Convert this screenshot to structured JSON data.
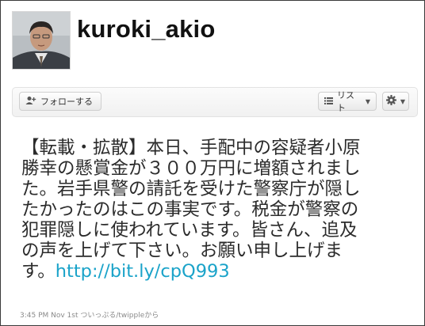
{
  "profile": {
    "username": "kuroki_akio",
    "avatar_icon": "profile-photo"
  },
  "actions": {
    "follow_label": "フォローする",
    "follow_icon": "add-person-icon",
    "list_label": "リスト",
    "list_icon": "list-icon",
    "gear_icon": "gear-icon"
  },
  "tweet": {
    "text": "【転載・拡散】本日、手配中の容疑者小原勝幸の懸賞金が３００万円に増額されました。岩手県警の請託を受けた警察庁が隠したかったのはこの事実です。税金が警察の犯罪隠しに使われています。皆さん、追及の声を上げて下さい。お願い申し上げます。",
    "link": "http://bit.ly/cpQ993",
    "meta": "3:45 PM Nov 1st ついっぷる/twippleから"
  },
  "colors": {
    "link": "#1aa3c9",
    "text": "#2b2b2b",
    "meta": "#8a8a8a"
  }
}
